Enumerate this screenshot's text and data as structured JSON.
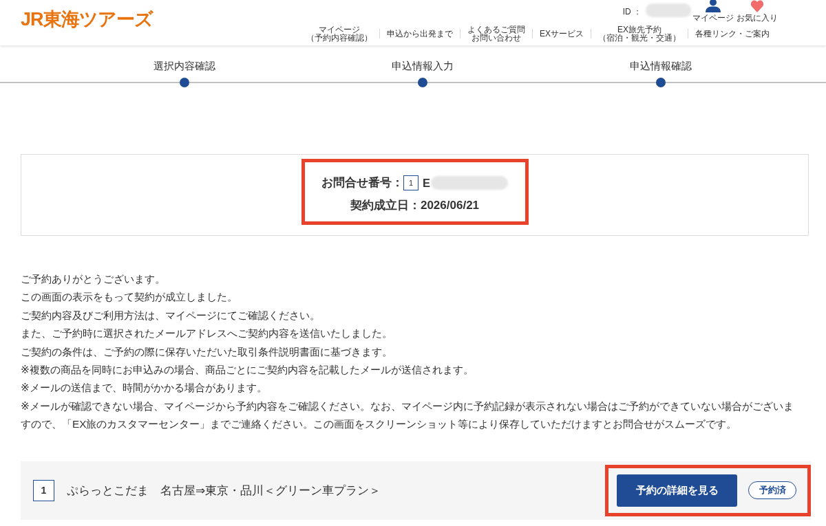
{
  "header": {
    "logo": "JR東海ツアーズ",
    "id_label": "ID ：",
    "id_redacted": true,
    "icon_links": [
      {
        "kind": "user",
        "label": "マイページ"
      },
      {
        "kind": "heart",
        "label": "お気に入り"
      }
    ],
    "nav": [
      {
        "lines": [
          "マイページ",
          "（予約内容確認）"
        ]
      },
      {
        "lines": [
          "申込から出発まで"
        ]
      },
      {
        "lines": [
          "よくあるご質問",
          "お問い合わせ"
        ]
      },
      {
        "lines": [
          "EXサービス"
        ]
      },
      {
        "lines": [
          "EX旅先予約",
          "（宿泊・観光・交通）"
        ]
      },
      {
        "lines": [
          "各種リンク・ご案内"
        ]
      }
    ]
  },
  "steps": [
    {
      "label": "選択内容確認",
      "completed": true
    },
    {
      "label": "申込情報入力",
      "completed": true
    },
    {
      "label": "申込情報確認",
      "completed": true
    }
  ],
  "info_box": {
    "highlighted": true,
    "inquiry_label": "お問合せ番号：",
    "item_number": "1",
    "inquiry_number": "E",
    "inquiry_redacted": true,
    "date_label": "契約成立日：2026/06/21"
  },
  "messages": [
    "ご予約ありがとうございます。",
    "この画面の表示をもって契約が成立しました。",
    "ご契約内容及びご利用方法は、マイページにてご確認ください。",
    "また、ご予約時に選択されたメールアドレスへご契約内容を送信いたしました。",
    "ご契約の条件は、ご予約の際に保存いただいた取引条件説明書面に基づきます。",
    "※複数の商品を同時にお申込みの場合、商品ごとにご契約内容を記載したメールが送信されます。",
    "※メールの送信まで、時間がかかる場合があります。",
    "※メールが確認できない場合、マイページから予約内容をご確認ください。なお、マイページ内に予約記録が表示されない場合はご予約ができていない場合がございますので、「EX旅のカスタマーセンター」までご連絡ください。この画面をスクリーンショット等により保存していただけますとお問合せがスムーズです。"
  ],
  "bookings": [
    {
      "number": "1",
      "title": "ぷらっとこだま　名古屋⇒東京・品川＜グリーン車プラン＞",
      "button": "予約の詳細を見る",
      "status": "予約済",
      "highlighted": true
    }
  ]
}
